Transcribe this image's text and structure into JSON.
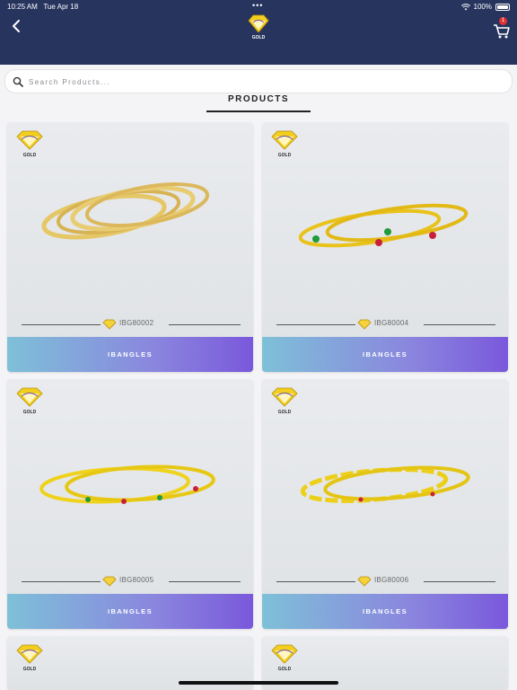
{
  "status": {
    "time": "10:25 AM",
    "date": "Tue Apr 18",
    "battery": "100%"
  },
  "header": {
    "logo_text": "GOLD",
    "cart_count": "1"
  },
  "search": {
    "placeholder": "Search Products..."
  },
  "tabs": [
    {
      "label": "Products",
      "active": true
    }
  ],
  "products": [
    {
      "code": "IBG80002",
      "category": "IBANGLES"
    },
    {
      "code": "IBG80004",
      "category": "IBANGLES"
    },
    {
      "code": "IBG80005",
      "category": "IBANGLES"
    },
    {
      "code": "IBG80006",
      "category": "IBANGLES"
    },
    {
      "code": "",
      "category": ""
    },
    {
      "code": "",
      "category": ""
    }
  ],
  "colors": {
    "header_bg": "#27345e",
    "accent_gradient_start": "#7ec0d8",
    "accent_gradient_end": "#7a58dc",
    "gold": "#e9c21a"
  }
}
